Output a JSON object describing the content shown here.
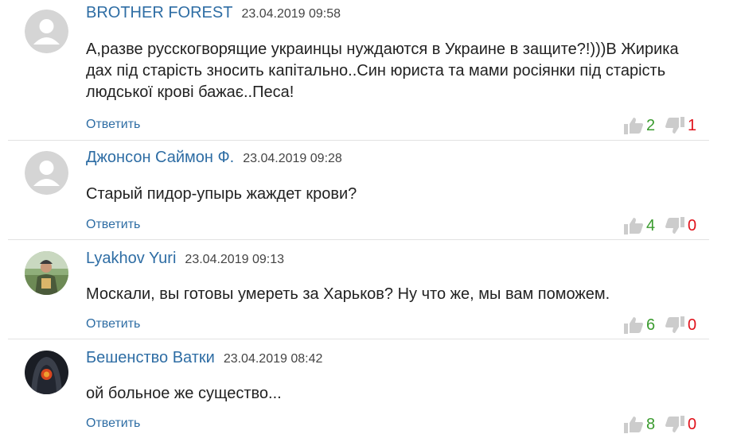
{
  "colors": {
    "link": "#2e6da4",
    "up": "#3a9b2e",
    "down": "#e0121b",
    "thumb": "#cccccc"
  },
  "comments": [
    {
      "author": "BROTHER FOREST",
      "date": "23.04.2019 09:58",
      "avatar": "default-avatar",
      "text": "А,разве русскогворящие украинцы нуждаются в Украине в защите?!)))В Жирика дах під старість зносить капітально..Син юриста та мами росіянки під старість людської крові бажає..Песа!",
      "reply": "Ответить",
      "likes": "2",
      "dislikes": "1"
    },
    {
      "author": "Джонсон Саймон Ф.",
      "date": "23.04.2019 09:28",
      "avatar": "default-avatar",
      "text": "Старый пидор-упырь жаждет крови?",
      "reply": "Ответить",
      "likes": "4",
      "dislikes": "0"
    },
    {
      "author": "Lyakhov Yuri",
      "date": "23.04.2019 09:13",
      "avatar": "photo-avatar",
      "text": "Москали, вы готовы умереть за Харьков? Ну что же, мы вам поможем.",
      "reply": "Ответить",
      "likes": "6",
      "dislikes": "0"
    },
    {
      "author": "Бешенство Ватки",
      "date": "23.04.2019 08:42",
      "avatar": "hooded-figure-avatar",
      "text": "ой больное же существо...",
      "reply": "Ответить",
      "likes": "8",
      "dislikes": "0"
    }
  ]
}
